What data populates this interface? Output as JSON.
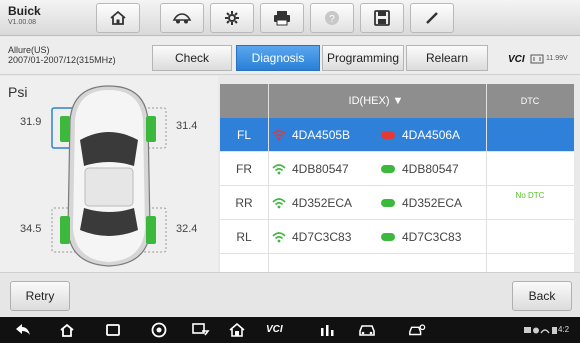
{
  "app": {
    "brand": "Buick",
    "version": "V1.00.08"
  },
  "toolbar": {
    "icons": [
      "home-icon",
      "vehicle-swap-icon",
      "settings-gear-icon",
      "print-icon",
      "help-icon",
      "save-icon",
      "edit-pen-icon"
    ]
  },
  "vehicle": {
    "model": "Allure(US)",
    "years": "2007/01-2007/12(315MHz)"
  },
  "tabs": [
    {
      "label": "Check",
      "active": false
    },
    {
      "label": "Diagnosis",
      "active": true
    },
    {
      "label": "Programming",
      "active": false
    },
    {
      "label": "Relearn",
      "active": false
    }
  ],
  "status": {
    "vci_label": "VCI",
    "voltage": "11.99V"
  },
  "pressure": {
    "unit": "Psi",
    "fl": "31.9",
    "fr": "31.4",
    "rl": "34.5",
    "rr": "32.4"
  },
  "table": {
    "header_id": "ID(HEX) ▼",
    "header_dtc": "DTC",
    "rows": [
      {
        "pos": "FL",
        "id_wireless": "4DA4505B",
        "id_tool": "4DA4506A",
        "selected": true
      },
      {
        "pos": "FR",
        "id_wireless": "4DB80547",
        "id_tool": "4DB80547",
        "selected": false
      },
      {
        "pos": "RR",
        "id_wireless": "4D352ECA",
        "id_tool": "4D352ECA",
        "selected": false
      },
      {
        "pos": "RL",
        "id_wireless": "4D7C3C83",
        "id_tool": "4D7C3C83",
        "selected": false
      }
    ],
    "dtc_text": "No DTC"
  },
  "buttons": {
    "retry": "Retry",
    "back": "Back"
  },
  "sysbar": {
    "vci_text": "VCI",
    "time": "4:2"
  },
  "colors": {
    "accent": "#2f80d8",
    "ok_green": "#5bbf2a",
    "alert_red": "#e53935"
  }
}
